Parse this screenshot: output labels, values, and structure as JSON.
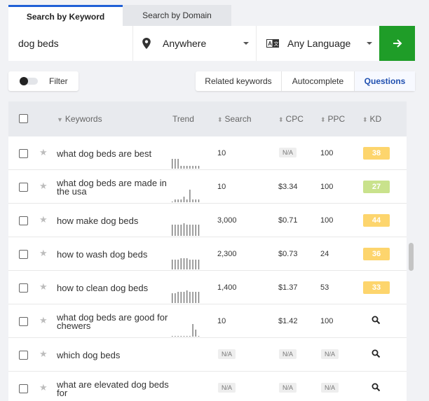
{
  "tabs": [
    {
      "label": "Search by Keyword",
      "active": true
    },
    {
      "label": "Search by Domain",
      "active": false
    }
  ],
  "search": {
    "keyword": "dog beds",
    "location": "Anywhere",
    "language": "Any Language"
  },
  "filter": {
    "label": "Filter",
    "enabled": false
  },
  "modes": [
    {
      "label": "Related keywords",
      "active": false
    },
    {
      "label": "Autocomplete",
      "active": false
    },
    {
      "label": "Questions",
      "active": true
    }
  ],
  "table": {
    "headers": {
      "keywords": "Keywords",
      "trend": "Trend",
      "search": "Search",
      "cpc": "CPC",
      "ppc": "PPC",
      "kd": "KD"
    },
    "rows": [
      {
        "keyword": "what dog beds are best",
        "search": "10",
        "cpc": "N/A",
        "ppc": "100",
        "kd": "38",
        "trend": [
          0.7,
          0.7,
          0.7,
          0.2,
          0.2,
          0.2,
          0.2,
          0.2,
          0.2,
          0.2
        ]
      },
      {
        "keyword": "what dog beds are made in the usa",
        "search": "10",
        "cpc": "$3.34",
        "ppc": "100",
        "kd": "27",
        "trend": [
          0.0,
          0.2,
          0.2,
          0.2,
          0.4,
          0.2,
          0.9,
          0.2,
          0.2,
          0.2
        ]
      },
      {
        "keyword": "how make dog beds",
        "search": "3,000",
        "cpc": "$0.71",
        "ppc": "100",
        "kd": "44",
        "trend": [
          0.8,
          0.8,
          0.8,
          0.8,
          0.9,
          0.8,
          0.8,
          0.8,
          0.8,
          0.8
        ]
      },
      {
        "keyword": "how to wash dog beds",
        "search": "2,300",
        "cpc": "$0.73",
        "ppc": "24",
        "kd": "36",
        "trend": [
          0.7,
          0.7,
          0.7,
          0.8,
          0.8,
          0.8,
          0.7,
          0.7,
          0.7,
          0.7
        ]
      },
      {
        "keyword": "how to clean dog beds",
        "search": "1,400",
        "cpc": "$1.37",
        "ppc": "53",
        "kd": "33",
        "trend": [
          0.7,
          0.7,
          0.8,
          0.8,
          0.8,
          0.9,
          0.8,
          0.8,
          0.8,
          0.8
        ]
      },
      {
        "keyword": "what dog beds are good for chewers",
        "search": "10",
        "cpc": "$1.42",
        "ppc": "100",
        "kd": "",
        "trend": [
          0.0,
          0.0,
          0.0,
          0.0,
          0.0,
          0.0,
          0.0,
          0.9,
          0.5,
          0.0
        ]
      },
      {
        "keyword": "which dog beds",
        "search": "N/A",
        "cpc": "N/A",
        "ppc": "N/A",
        "kd": "",
        "trend": []
      },
      {
        "keyword": "what are elevated dog beds for",
        "search": "N/A",
        "cpc": "N/A",
        "ppc": "N/A",
        "kd": "",
        "trend": []
      }
    ]
  },
  "colors": {
    "accent": "#1f5fd6",
    "go_button": "#1f9d28",
    "kd_yellow": "#fdd56d",
    "kd_green": "#c9e28c"
  },
  "icons": {
    "location": "pin-icon",
    "language": "translate-icon",
    "go": "arrow-right-icon",
    "favorite": "star-icon",
    "kd_lookup": "search-icon"
  }
}
